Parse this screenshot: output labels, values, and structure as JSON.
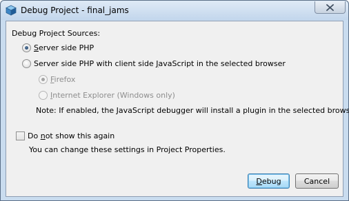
{
  "window": {
    "title": "Debug Project - final_jams",
    "close_icon": "close-icon"
  },
  "sources": {
    "heading": "Debug Project Sources:",
    "option_server": {
      "pre": "",
      "mnemonic": "S",
      "post": "erver side PHP",
      "selected": true
    },
    "option_client": {
      "pre": "Server side PHP with client side ",
      "mnemonic": "J",
      "post": "avaScript in the selected browser",
      "selected": false
    },
    "browser_firefox": {
      "pre": "",
      "mnemonic": "F",
      "post": "irefox",
      "selected": true,
      "enabled": false
    },
    "browser_ie": {
      "pre": "",
      "mnemonic": "I",
      "post": "nternet Explorer (Windows only)",
      "selected": false,
      "enabled": false
    },
    "note": "Note: If enabled, the JavaScript debugger will install a plugin in the selected browser."
  },
  "dont_show": {
    "pre": "Do ",
    "mnemonic": "n",
    "post": "ot show this again",
    "checked": false,
    "hint": "You can change these settings in Project Properties."
  },
  "buttons": {
    "debug": {
      "pre": "",
      "mnemonic": "D",
      "post": "ebug"
    },
    "cancel": "Cancel"
  }
}
